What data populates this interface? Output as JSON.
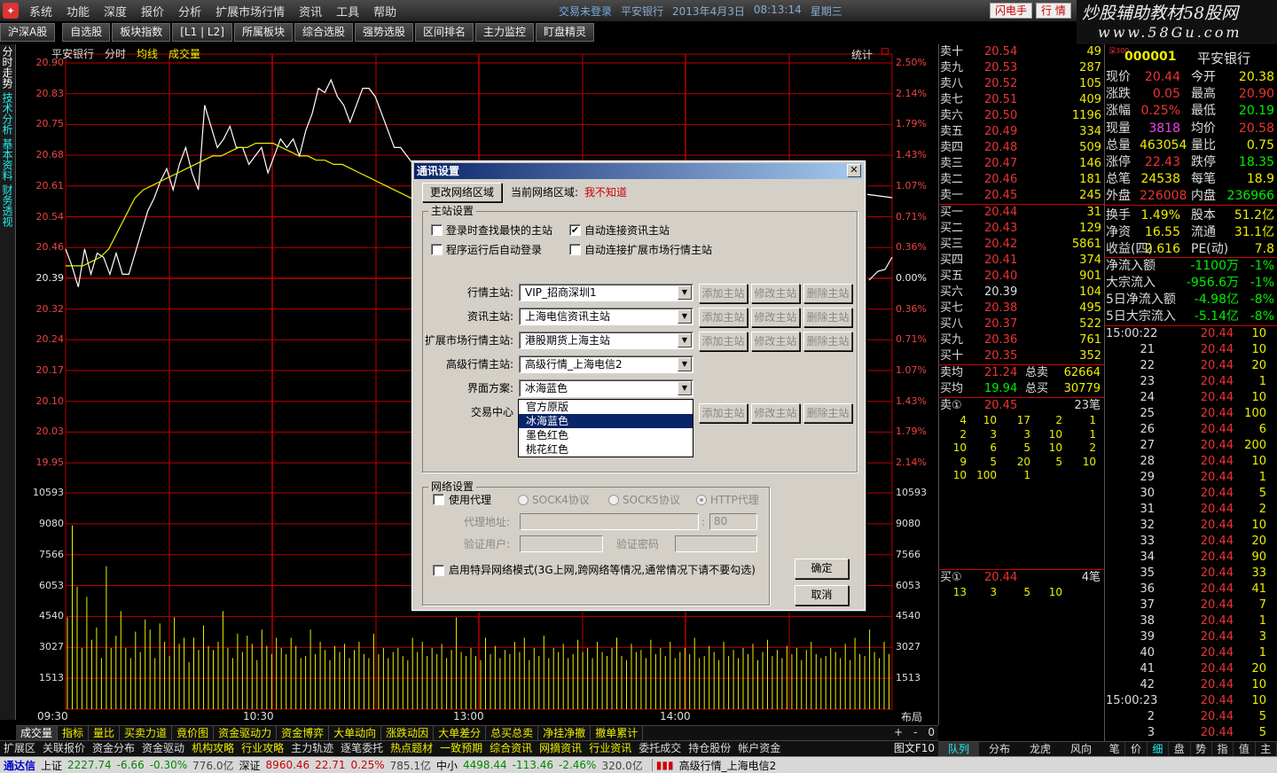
{
  "menubar": {
    "items": [
      "系统",
      "功能",
      "深度",
      "报价",
      "分析",
      "扩展市场行情",
      "资讯",
      "工具",
      "帮助"
    ],
    "trade_status": "交易未登录",
    "stock_name": "平安银行",
    "date": "2013年4月3日",
    "time": "08:13:14",
    "weekday": "星期三",
    "btn_flash": "闪电手",
    "btn_trade": "行 情"
  },
  "watermark": {
    "line1": "炒股辅助教材58股网",
    "line2": "www.58Gu.com"
  },
  "toolbar": {
    "items": [
      "沪深A股",
      "自选股",
      "板块指数",
      "[L1 | L2]",
      "所属板块",
      "综合选股",
      "强势选股",
      "区间排名",
      "主力监控",
      "盯盘精灵"
    ]
  },
  "sidetabs": [
    "分时走势",
    "技术分析",
    "基本资料",
    "财务透视"
  ],
  "chart": {
    "stock": "平安银行",
    "mode": "分时",
    "avg": "均线",
    "vol": "成交量",
    "stat": "统计",
    "y_labels": [
      "20.90",
      "20.83",
      "20.75",
      "20.68",
      "20.61",
      "20.54",
      "20.46",
      "20.39",
      "20.32",
      "20.24",
      "20.17",
      "20.10",
      "20.03",
      "19.95"
    ],
    "pct_labels": [
      "2.50%",
      "2.14%",
      "1.79%",
      "1.43%",
      "1.07%",
      "0.71%",
      "0.36%",
      "0.00%",
      "0.36%",
      "0.71%",
      "1.07%",
      "1.43%",
      "1.79%",
      "2.14%"
    ],
    "vol_labels": [
      "10593",
      "9080",
      "7566",
      "6053",
      "4540",
      "3027",
      "1513"
    ],
    "x_labels": [
      "09:30",
      "10:30",
      "13:00",
      "14:00"
    ],
    "layout_label": "布局",
    "pm_controls": [
      "+",
      "-",
      "0"
    ]
  },
  "chart_data": {
    "type": "line",
    "title": "",
    "ylim": [
      19.95,
      20.9
    ],
    "price_series": [
      20.46,
      20.42,
      20.37,
      20.46,
      20.4,
      20.45,
      20.44,
      20.4,
      20.45,
      20.4,
      20.4,
      20.45,
      20.5,
      20.55,
      20.58,
      20.62,
      20.65,
      20.6,
      20.66,
      20.7,
      20.64,
      20.6,
      20.8,
      20.75,
      20.7,
      20.72,
      20.75,
      20.7,
      20.7,
      20.66,
      20.68,
      20.7,
      20.64,
      20.68,
      20.72,
      20.7,
      20.72,
      20.68,
      20.74,
      20.78,
      20.84,
      20.83,
      20.86,
      20.82,
      20.8,
      20.76,
      20.8,
      20.84,
      20.84,
      20.82,
      20.78,
      20.74,
      20.7,
      20.7,
      20.68,
      20.66
    ],
    "avg_series": [
      20.42,
      20.42,
      20.42,
      20.43,
      20.44,
      20.46,
      20.5,
      20.54,
      20.58,
      20.6,
      20.61,
      20.62,
      20.63,
      20.64,
      20.65,
      20.66,
      20.67,
      20.68,
      20.68,
      20.69,
      20.7,
      20.7,
      20.71,
      20.71,
      20.71,
      20.7,
      20.69,
      20.68,
      20.68,
      20.67,
      20.67,
      20.66,
      20.66,
      20.65,
      20.64,
      20.63,
      20.62,
      20.61,
      20.6,
      20.59,
      20.58,
      20.58,
      20.57,
      20.56,
      20.56,
      20.55,
      20.55,
      20.54,
      20.54,
      20.53,
      20.53,
      20.52,
      20.52,
      20.51,
      20.51,
      20.5
    ],
    "volumes": [
      4500,
      9000,
      6000,
      3000,
      5500,
      3400,
      4000,
      2500,
      7000,
      3000,
      3600,
      4800,
      3000,
      2500,
      3800,
      2800,
      4400,
      3900,
      2500,
      4200,
      3300,
      2600,
      4500,
      3200,
      3500,
      2300,
      3500,
      2900,
      4100,
      3100,
      2900,
      3300,
      4800,
      3000,
      2500,
      3700,
      2800,
      3600,
      3200,
      2400,
      3900,
      3100,
      2700,
      3500,
      3000,
      2700,
      3500,
      3100,
      2500,
      2600,
      3900,
      2700,
      3300,
      2900,
      2400,
      3100,
      2800,
      3200,
      2500,
      2900,
      3300,
      2700,
      2500,
      3700,
      2700,
      3000,
      2500,
      2800,
      3000,
      2600,
      2400,
      3500,
      2800,
      3300,
      2600,
      3000,
      2700,
      3200,
      2500,
      2900,
      4500,
      2800,
      2600,
      3000,
      2600,
      2400,
      3500,
      2700,
      3100,
      2500,
      2900,
      2700,
      3300,
      2800,
      3500,
      2400,
      3000,
      2600,
      3600,
      2500,
      3000,
      2800,
      3200,
      2500,
      2700,
      3400,
      2800,
      3000,
      2500,
      3300,
      2800,
      2600,
      3000,
      3500,
      2600,
      2400,
      3200,
      2800,
      2900,
      2500,
      3400,
      2700,
      3000,
      2600,
      3300,
      2500,
      2800,
      3000,
      2700,
      3500,
      2500,
      2600,
      3100,
      2800,
      2400,
      3300,
      2600,
      2900,
      2500,
      3000,
      2700,
      3200,
      2400,
      2800,
      3400,
      2600,
      2900,
      2500,
      3100,
      2700,
      3000,
      2400,
      2900,
      3300,
      2700,
      2500,
      2600,
      3000,
      2800,
      2500,
      3200,
      2400,
      3500,
      2700,
      2600,
      3900,
      2800,
      2500,
      3300,
      2700
    ]
  },
  "bottomtabs1": [
    "成交量",
    "指标",
    "量比",
    "买卖力道",
    "竟价图",
    "资金驱动力",
    "资金博弈",
    "大单动向",
    "涨跌动因",
    "大单差分",
    "总买总卖",
    "净挂净撤",
    "撤单累计"
  ],
  "bottomtabs2": [
    "扩展区",
    "关联报价",
    "资金分布",
    "资金驱动",
    "机构攻略",
    "行业攻略",
    "主力轨迹",
    "逐笔委托",
    "热点题材",
    "一致预期",
    "综合资讯",
    "网摘资讯",
    "行业资讯",
    "委托成交",
    "持仓股份",
    "帐户资金",
    "图文F10"
  ],
  "orderbook": {
    "sell": [
      {
        "lab": "卖十",
        "pr": "20.54",
        "vol": "49",
        "flag": "s"
      },
      {
        "lab": "卖九",
        "pr": "20.53",
        "vol": "287"
      },
      {
        "lab": "卖八",
        "pr": "20.52",
        "vol": "105"
      },
      {
        "lab": "卖七",
        "pr": "20.51",
        "vol": "409"
      },
      {
        "lab": "卖六",
        "pr": "20.50",
        "vol": "1196"
      },
      {
        "lab": "卖五",
        "pr": "20.49",
        "vol": "334"
      },
      {
        "lab": "卖四",
        "pr": "20.48",
        "vol": "509"
      },
      {
        "lab": "卖三",
        "pr": "20.47",
        "vol": "146"
      },
      {
        "lab": "卖二",
        "pr": "20.46",
        "vol": "181"
      },
      {
        "lab": "卖一",
        "pr": "20.45",
        "vol": "245"
      }
    ],
    "buy": [
      {
        "lab": "买一",
        "pr": "20.44",
        "vol": "31"
      },
      {
        "lab": "买二",
        "pr": "20.43",
        "vol": "129"
      },
      {
        "lab": "买三",
        "pr": "20.42",
        "vol": "5861"
      },
      {
        "lab": "买四",
        "pr": "20.41",
        "vol": "374"
      },
      {
        "lab": "买五",
        "pr": "20.40",
        "vol": "901"
      },
      {
        "lab": "买六",
        "pr": "20.39",
        "vol": "104"
      },
      {
        "lab": "买七",
        "pr": "20.38",
        "vol": "495"
      },
      {
        "lab": "买八",
        "pr": "20.37",
        "vol": "522"
      },
      {
        "lab": "买九",
        "pr": "20.36",
        "vol": "761"
      },
      {
        "lab": "买十",
        "pr": "20.35",
        "vol": "352",
        "flag": "s"
      }
    ],
    "sell_avg": {
      "lab": "卖均",
      "v1": "21.24",
      "lab2": "总卖",
      "v2": "62664"
    },
    "buy_avg": {
      "lab": "买均",
      "v1": "19.94",
      "lab2": "总买",
      "v2": "30779"
    },
    "sell1": {
      "lab": "卖①",
      "v1": "20.45",
      "v2": "23笔"
    },
    "sell_queue": [
      [
        "4",
        "10",
        "17",
        "2",
        "1"
      ],
      [
        "2",
        "3",
        "3",
        "10",
        "1"
      ],
      [
        "10",
        "6",
        "5",
        "10",
        "2"
      ],
      [
        "9",
        "5",
        "20",
        "5",
        "10"
      ],
      [
        "10",
        "100",
        "1",
        "",
        ""
      ]
    ],
    "buy1": {
      "lab": "买①",
      "v1": "20.44",
      "v2": "4笔"
    },
    "buy_queue": [
      [
        "13",
        "3",
        "5",
        "10",
        ""
      ]
    ],
    "tabs": [
      "队列",
      "分布",
      "龙虎",
      "风向"
    ]
  },
  "quote": {
    "exch": "深300",
    "code": "000001",
    "name": "平安银行",
    "rows": [
      {
        "l1": "现价",
        "v1": "20.44",
        "l2": "今开",
        "v2": "20.38",
        "c1": "#e33",
        "c2": "#ee0"
      },
      {
        "l1": "涨跌",
        "v1": "0.05",
        "l2": "最高",
        "v2": "20.90",
        "c1": "#e33",
        "c2": "#e33"
      },
      {
        "l1": "涨幅",
        "v1": "0.25%",
        "l2": "最低",
        "v2": "20.19",
        "c1": "#e33",
        "c2": "#0e0"
      },
      {
        "l1": "现量",
        "v1": "3818",
        "l2": "均价",
        "v2": "20.58",
        "c1": "#e4e",
        "c2": "#e33"
      },
      {
        "l1": "总量",
        "v1": "463054",
        "l2": "量比",
        "v2": "0.75",
        "c1": "#ee0",
        "c2": "#ee0"
      },
      {
        "l1": "涨停",
        "v1": "22.43",
        "l2": "跌停",
        "v2": "18.35",
        "c1": "#e33",
        "c2": "#0e0"
      },
      {
        "l1": "总笔",
        "v1": "24538",
        "l2": "每笔",
        "v2": "18.9",
        "c1": "#ee0",
        "c2": "#ee0"
      },
      {
        "l1": "外盘",
        "v1": "226008",
        "l2": "内盘",
        "v2": "236966",
        "c1": "#e33",
        "c2": "#0e0"
      },
      {
        "l1": "换手",
        "v1": "1.49%",
        "l2": "股本",
        "v2": "51.2亿",
        "c1": "#ee0",
        "c2": "#ee0"
      },
      {
        "l1": "净资",
        "v1": "16.55",
        "l2": "流通",
        "v2": "31.1亿",
        "c1": "#ee0",
        "c2": "#ee0"
      },
      {
        "l1": "收益(四)",
        "v1": "2.616",
        "l2": "PE(动)",
        "v2": "7.8",
        "c1": "#ee0",
        "c2": "#ee0"
      }
    ],
    "flows": [
      {
        "l1": "净流入额",
        "v1": "-1100万",
        "v2": "-1%"
      },
      {
        "l1": "大宗流入",
        "v1": "-956.6万",
        "v2": "-1%"
      },
      {
        "l1": "5日净流入额",
        "v1": "-4.98亿",
        "v2": "-8%"
      },
      {
        "l1": "5日大宗流入",
        "v1": "-5.14亿",
        "v2": "-8%"
      }
    ],
    "ticks": [
      {
        "tm": "15:00:22",
        "tp": "20.44",
        "tv": "10",
        "bs": "s"
      },
      {
        "tm": "21",
        "tp": "20.44",
        "tv": "10",
        "bs": ""
      },
      {
        "tm": "22",
        "tp": "20.44",
        "tv": "20",
        "bs": ""
      },
      {
        "tm": "23",
        "tp": "20.44",
        "tv": "1",
        "bs": ""
      },
      {
        "tm": "24",
        "tp": "20.44",
        "tv": "10",
        "bs": ""
      },
      {
        "tm": "25",
        "tp": "20.44",
        "tv": "100",
        "bs": ""
      },
      {
        "tm": "26",
        "tp": "20.44",
        "tv": "6",
        "bs": ""
      },
      {
        "tm": "27",
        "tp": "20.44",
        "tv": "200",
        "bs": ""
      },
      {
        "tm": "28",
        "tp": "20.44",
        "tv": "10",
        "bs": ""
      },
      {
        "tm": "29",
        "tp": "20.44",
        "tv": "1",
        "bs": ""
      },
      {
        "tm": "30",
        "tp": "20.44",
        "tv": "5",
        "bs": ""
      },
      {
        "tm": "31",
        "tp": "20.44",
        "tv": "2",
        "bs": ""
      },
      {
        "tm": "32",
        "tp": "20.44",
        "tv": "10",
        "bs": ""
      },
      {
        "tm": "33",
        "tp": "20.44",
        "tv": "20",
        "bs": ""
      },
      {
        "tm": "34",
        "tp": "20.44",
        "tv": "90",
        "bs": ""
      },
      {
        "tm": "35",
        "tp": "20.44",
        "tv": "33",
        "bs": ""
      },
      {
        "tm": "36",
        "tp": "20.44",
        "tv": "41",
        "bs": ""
      },
      {
        "tm": "37",
        "tp": "20.44",
        "tv": "7",
        "bs": ""
      },
      {
        "tm": "38",
        "tp": "20.44",
        "tv": "1",
        "bs": ""
      },
      {
        "tm": "39",
        "tp": "20.44",
        "tv": "3",
        "bs": ""
      },
      {
        "tm": "40",
        "tp": "20.44",
        "tv": "1",
        "bs": ""
      },
      {
        "tm": "41",
        "tp": "20.44",
        "tv": "20",
        "bs": ""
      },
      {
        "tm": "42",
        "tp": "20.44",
        "tv": "10",
        "bs": ""
      },
      {
        "tm": "15:00:23",
        "tp": "20.44",
        "tv": "10",
        "bs": ""
      },
      {
        "tm": "2",
        "tp": "20.44",
        "tv": "5",
        "bs": ""
      },
      {
        "tm": "3",
        "tp": "20.44",
        "tv": "5",
        "bs": ""
      }
    ],
    "tabs": [
      "笔",
      "价",
      "细",
      "盘",
      "势",
      "指",
      "值",
      "主"
    ]
  },
  "status": {
    "app": "通达信",
    "sh_label": "上证",
    "sh_val": "2227.74",
    "sh_chg": "-6.66",
    "sh_pct": "-0.30%",
    "sh_amt": "776.0亿",
    "sz_label": "深证",
    "sz_val": "8960.46",
    "sz_chg": "22.71",
    "sz_pct": "0.25%",
    "sz_amt": "785.1亿",
    "zx_label": "中小",
    "zx_val": "4498.44",
    "zx_chg": "-113.46",
    "zx_pct": "-2.46%",
    "zx_amt": "320.0亿",
    "server": "高级行情_上海电信2"
  },
  "dialog": {
    "title": "通讯设置",
    "change_region": "更改网络区域",
    "cur_region_label": "当前网络区域:",
    "cur_region_value": "我不知道",
    "main_group": "主站设置",
    "chk1": "登录时查找最快的主站",
    "chk2": "自动连接资讯主站",
    "chk3": "程序运行后自动登录",
    "chk4": "自动连接扩展市场行情主站",
    "row_hq": "行情主站:",
    "row_hq_val": "VIP_招商深圳1",
    "row_zx": "资讯主站:",
    "row_zx_val": "上海电信资讯主站",
    "row_ext": "扩展市场行情主站:",
    "row_ext_val": "港股期货上海主站",
    "row_adv": "高级行情主站:",
    "row_adv_val": "高级行情_上海电信2",
    "row_skin": "界面方案:",
    "row_skin_val": "冰海蓝色",
    "row_trade": "交易中心",
    "btn_add": "添加主站",
    "btn_edit": "修改主站",
    "btn_del": "删除主站",
    "skin_options": [
      "官方原版",
      "冰海蓝色",
      "墨色红色",
      "桃花红色"
    ],
    "net_group": "网络设置",
    "use_proxy": "使用代理",
    "sock4": "SOCK4协议",
    "sock5": "SOCK5协议",
    "http": "HTTP代理",
    "proxy_addr": "代理地址:",
    "proxy_port": "80",
    "auth_user": "验证用户:",
    "auth_pass": "验证密码",
    "special": "启用特异网络模式(3G上网,跨网络等情况,通常情况下请不要勾选)",
    "ok": "确定",
    "cancel": "取消"
  }
}
